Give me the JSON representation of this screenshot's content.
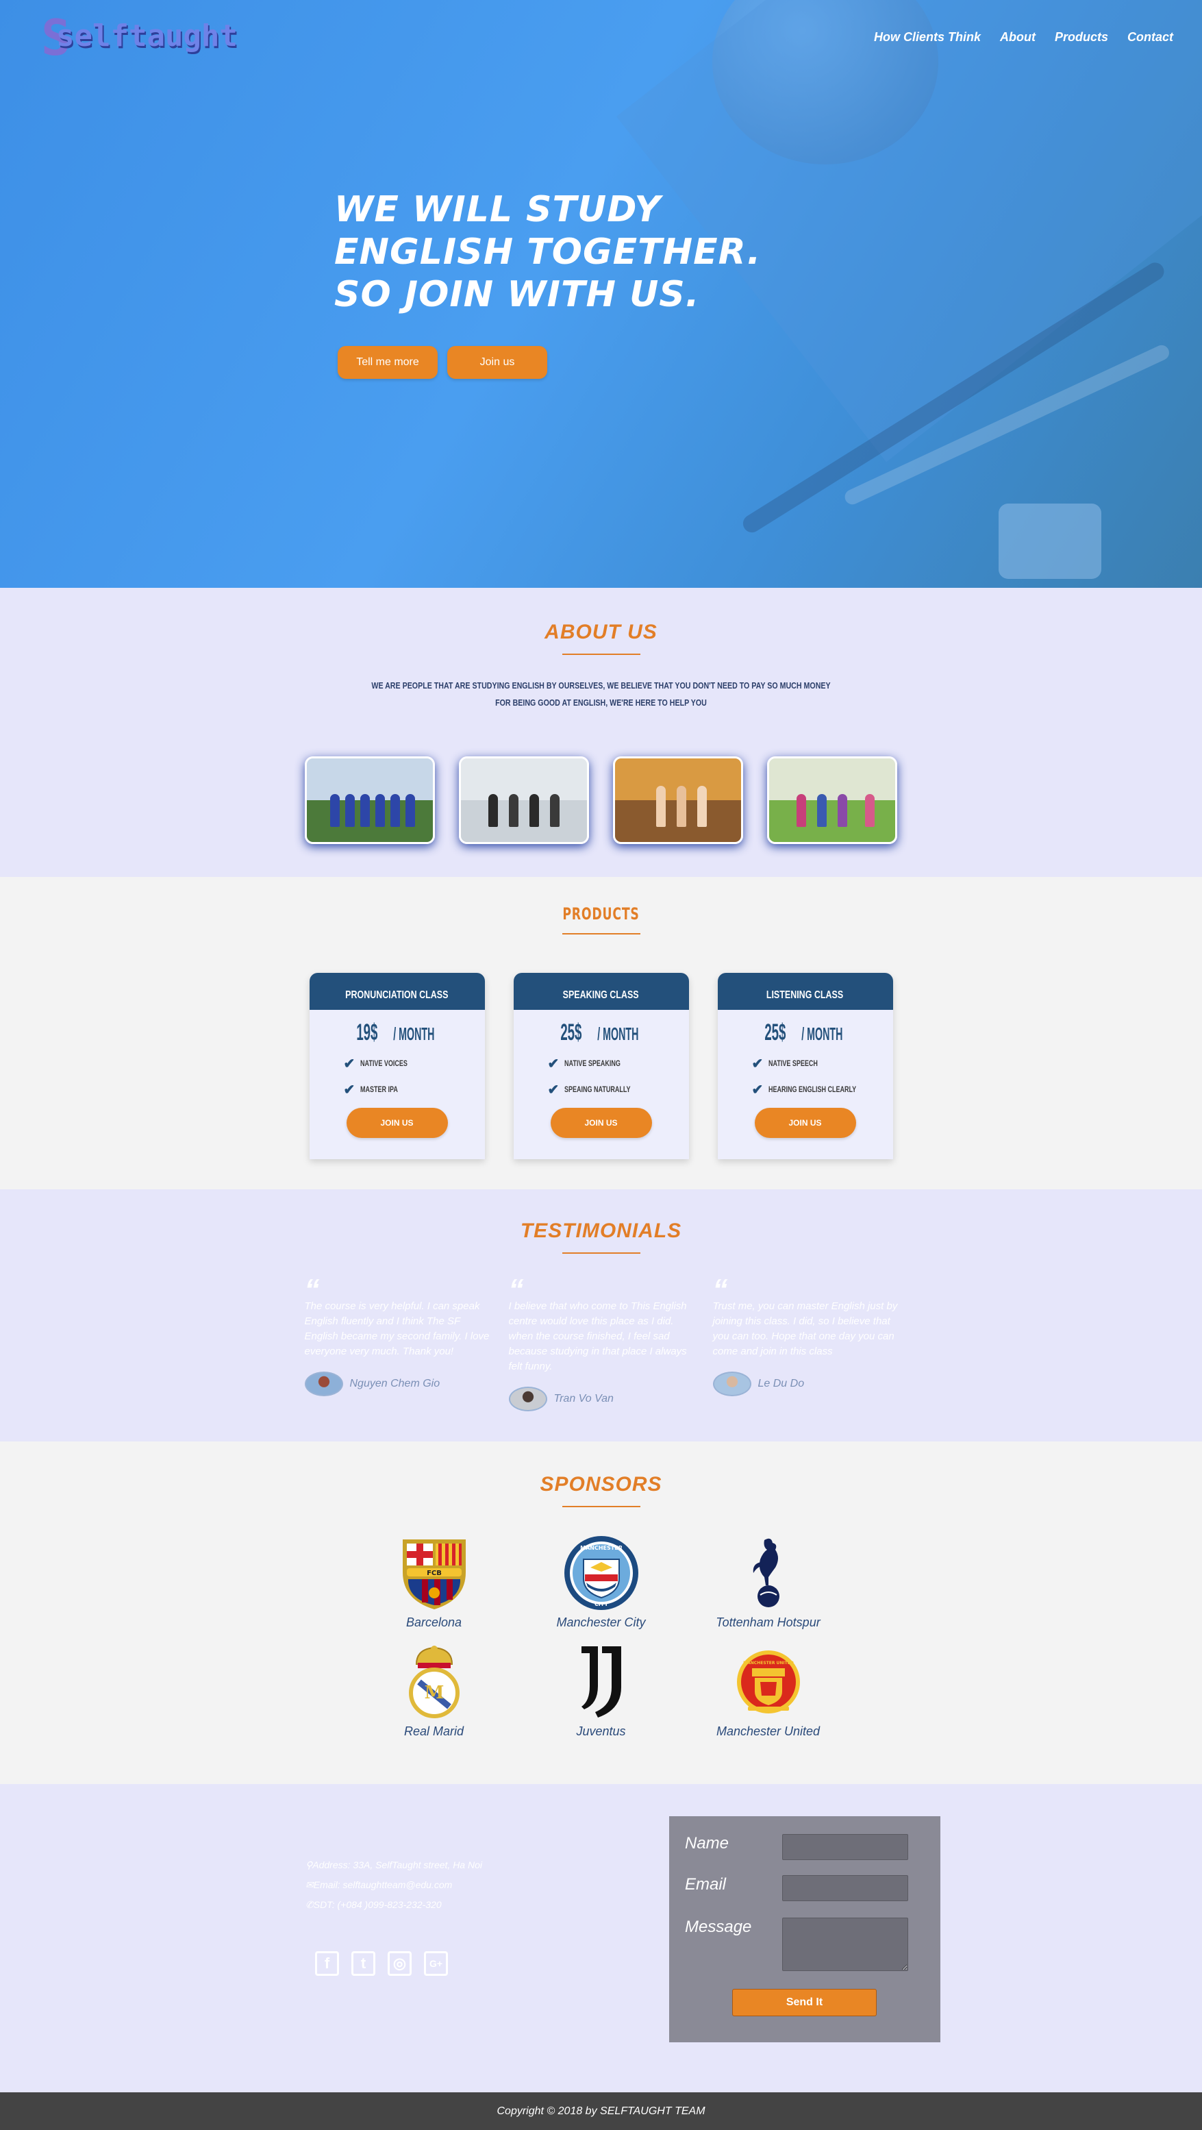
{
  "brand": {
    "logo_text": "selftaught"
  },
  "nav": [
    "How Clients Think",
    "About",
    "Products",
    "Contact"
  ],
  "hero": {
    "title_lines": [
      "WE WILL STUDY",
      "ENGLISH TOGETHER.",
      "SO JOIN WITH US."
    ],
    "btn_more": "Tell me more",
    "btn_join": "Join us"
  },
  "about": {
    "title": "ABOUT US",
    "text_line1": "WE ARE PEOPLE THAT ARE STUDYING ENGLISH BY OURSELVES, WE BELIEVE THAT YOU DON'T NEED TO PAY SO MUCH MONEY",
    "text_line2": "FOR BEING GOOD AT ENGLISH, WE'RE HERE TO HELP YOU"
  },
  "products": {
    "title": "PRODUCTS",
    "cards": [
      {
        "name": "PRONUNCIATION CLASS",
        "price": "19$",
        "unit": "/ MONTH",
        "features": [
          "NATIVE VOICES",
          "MASTER IPA"
        ],
        "button": "JOIN US"
      },
      {
        "name": "SPEAKING CLASS",
        "price": "25$",
        "unit": "/ MONTH",
        "features": [
          "NATIVE SPEAKING",
          "SPEAING NATURALLY"
        ],
        "button": "JOIN US"
      },
      {
        "name": "LISTENING CLASS",
        "price": "25$",
        "unit": "/ MONTH",
        "features": [
          "NATIVE SPEECH",
          "HEARING ENGLISH CLEARLY"
        ],
        "button": "JOIN US"
      }
    ]
  },
  "testimonials": {
    "title": "TESTIMONIALS",
    "quote_mark": "“",
    "items": [
      {
        "text": "The course is very helpful. I can speak English fluently and I think The SF English became my second family. I love everyone very much. Thank you!",
        "author": "Nguyen Chem Gio"
      },
      {
        "text": "I believe that who come to This English centre would love this place as I did. when the course finished, I feel sad because studying in that place I always felt funny.",
        "author": "Tran Vo Van"
      },
      {
        "text": "Trust me, you can master English just by joining this class. I did, so I believe that you can too. Hope that one day you can come and join in this class",
        "author": "Le Du Do"
      }
    ]
  },
  "sponsors": {
    "title": "SPONSORS",
    "items": [
      "Barcelona",
      "Manchester City",
      "Tottenham Hotspur",
      "Real Marid",
      "Juventus",
      "Manchester United"
    ],
    "crest_text": {
      "barca": "FCB",
      "city_top": "MANCHESTER",
      "city_bottom": "CITY",
      "united": "MANCHESTER UNITED"
    }
  },
  "contact": {
    "address": "Address: 33A, SelfTaught street, Ha Noi",
    "email": "Email: selftaughtteam@edu.com",
    "phone": "SDT: (+084 )099-823-232-320",
    "social_glyphs": [
      "f",
      "t",
      "◎",
      "G+"
    ],
    "form": {
      "name": "Name",
      "email": "Email",
      "message": "Message",
      "send": "Send It"
    }
  },
  "footer": {
    "copyright": "Copyright © 2018 by SELFTAUGHT TEAM"
  },
  "colors": {
    "accent": "#e98624",
    "navy": "#23507b",
    "lavender": "#e6e6fa"
  }
}
